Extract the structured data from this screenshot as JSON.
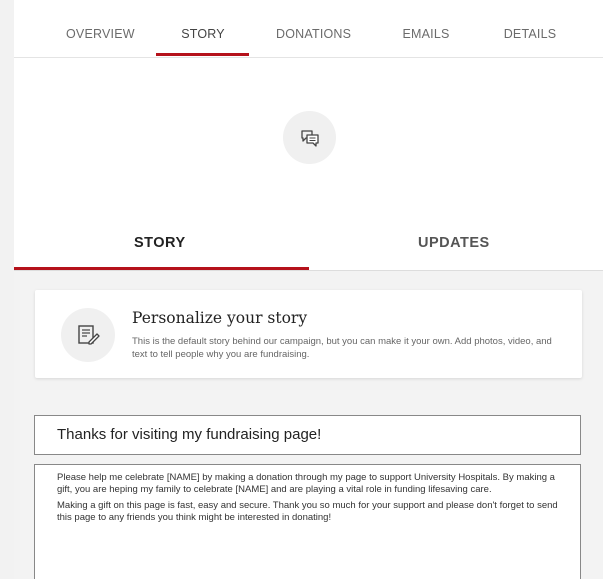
{
  "nav": {
    "tabs": [
      {
        "label": "OVERVIEW"
      },
      {
        "label": "STORY"
      },
      {
        "label": "DONATIONS"
      },
      {
        "label": "EMAILS"
      },
      {
        "label": "DETAILS"
      }
    ],
    "active_index": 1
  },
  "story_icon": "chat-bubbles-icon",
  "subtabs": {
    "story_label": "STORY",
    "updates_label": "UPDATES"
  },
  "personalize": {
    "icon": "document-edit-icon",
    "title": "Personalize your story",
    "description": "This is the default story behind our campaign, but you can make it your own. Add photos, video, and text to tell people why you are fundraising."
  },
  "editor": {
    "headline": "Thanks for visiting my fundraising page!",
    "paragraphs": [
      "Please help me celebrate [NAME] by making a donation through my page to support University Hospitals. By making a gift, you are heping my family to celebrate [NAME] and are playing a vital role in funding lifesaving care.",
      "Making a gift on this page is fast, easy and secure. Thank you so much for your support and please don't forget to send this page to any friends you think might be interested in donating!"
    ]
  },
  "colors": {
    "accent": "#b5121b",
    "background": "#f3f3f3"
  }
}
